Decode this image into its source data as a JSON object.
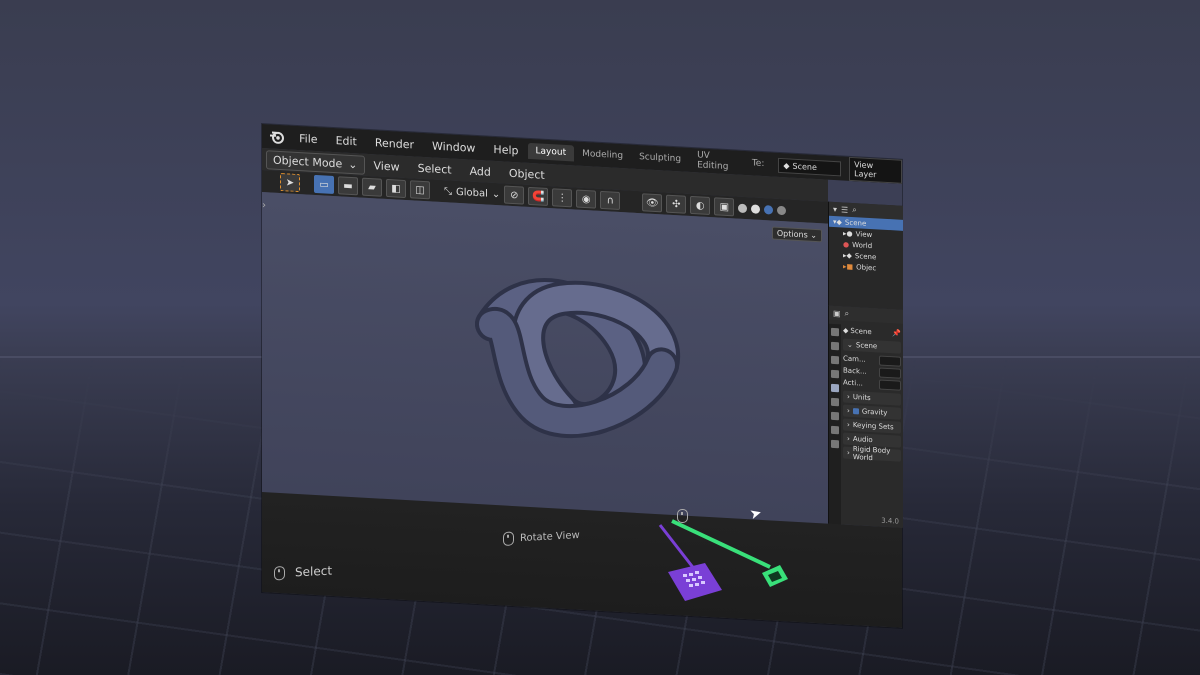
{
  "app": {
    "version": "3.4.0"
  },
  "topbar": {
    "menus": [
      "File",
      "Edit",
      "Render",
      "Window",
      "Help"
    ],
    "workspace_tabs": [
      "Layout",
      "Modeling",
      "Sculpting",
      "UV Editing",
      "Te:"
    ],
    "active_tab": "Layout",
    "scene_name": "Scene",
    "view_layer": "View Layer"
  },
  "viewport_header": {
    "mode": "Object Mode",
    "menus": [
      "View",
      "Select",
      "Add",
      "Object"
    ],
    "transform_orientation": "Global",
    "options_label": "Options"
  },
  "outliner": {
    "rows": [
      {
        "label": "Scene",
        "icon": "scene-icon",
        "selected": true
      },
      {
        "label": "View",
        "icon": "view-icon",
        "selected": false
      },
      {
        "label": "World",
        "icon": "world-icon",
        "selected": false
      },
      {
        "label": "Scene",
        "icon": "scene-icon",
        "selected": false
      },
      {
        "label": "Objec",
        "icon": "object-icon",
        "selected": false
      }
    ]
  },
  "properties": {
    "title": "Scene",
    "section": "Scene",
    "fields": [
      "Cam...",
      "Back...",
      "Acti..."
    ],
    "panels": [
      "Units",
      "Gravity",
      "Keying Sets",
      "Audio",
      "Rigid Body World"
    ]
  },
  "hints": {
    "rotate": "Rotate View",
    "select": "Select"
  },
  "colors": {
    "accent_blue": "#4772b3",
    "controller_left": "#7a3fd6",
    "controller_right": "#39e07a"
  }
}
